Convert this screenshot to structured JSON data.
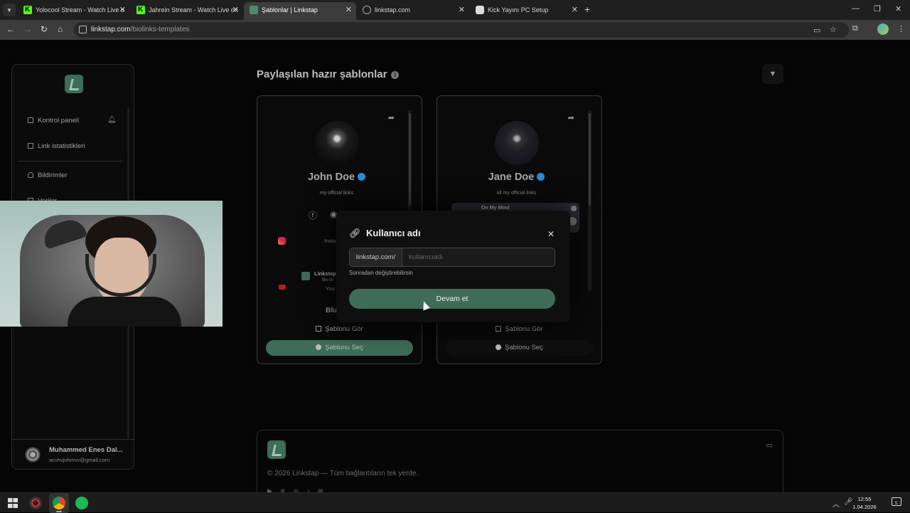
{
  "browser": {
    "tabs": [
      {
        "title": "Yolocool Stream - Watch Live o",
        "favicon": "kick-icon"
      },
      {
        "title": "Jahrein Stream - Watch Live on",
        "favicon": "kick-icon"
      },
      {
        "title": "Şablonlar | Linkstap",
        "favicon": "linkstap-icon"
      },
      {
        "title": "linkstap.com",
        "favicon": "globe-icon"
      },
      {
        "title": "Kick Yayını PC Setup",
        "favicon": "kick-pc-icon"
      }
    ],
    "active_tab": 2,
    "url_host": "linkstap.com",
    "url_path": "/biolinks-templates"
  },
  "sidebar": {
    "items": [
      {
        "label": "Kontrol paneli",
        "icon": "grid-icon"
      },
      {
        "label": "Link istatistikleri",
        "icon": "chart-icon"
      },
      {
        "label": "Bildirimler",
        "icon": "bell-icon"
      },
      {
        "label": "Veriler",
        "icon": "data-icon"
      }
    ],
    "user_name": "Muhammed Enes Dal...",
    "user_email": "acvhvjnhmvv@gmail.com"
  },
  "main": {
    "title": "Paylaşılan hazır şablonlar"
  },
  "cards": [
    {
      "name": "John Doe",
      "bio": "my official links",
      "link_instagram": "Insta",
      "link_linkstap": "Linkstap",
      "link_linkstap_sub": "Bio lin",
      "link_youtube": "You",
      "link_more": "Blu",
      "view_label": "Şablonu Gör",
      "select_label": "Şablonu Seç"
    },
    {
      "name": "Jane Doe",
      "bio": "all my official links",
      "widget_label": "On My Mind",
      "view_label": "Şablonu Gör",
      "select_label": "Şablonu Seç"
    }
  ],
  "modal": {
    "title": "Kullanıcı adı",
    "prefix": "linkstap.com/",
    "placeholder": "kullanıcıadı",
    "value": "",
    "hint": "Sonradan değiştirebilirsin",
    "submit_label": "Devam et"
  },
  "footer": {
    "copyright": "© 2026 Linkstap — Tüm bağlantıların tek yerde.",
    "social_icons": [
      "youtube-icon",
      "x-icon",
      "instagram-icon",
      "tiktok-icon",
      "mail-icon"
    ]
  },
  "taskbar": {
    "time": "12:55",
    "date": "1.04.2026",
    "notification_count": "5"
  },
  "colors": {
    "accent": "#3e6c59",
    "verified": "#2a8ad6"
  }
}
